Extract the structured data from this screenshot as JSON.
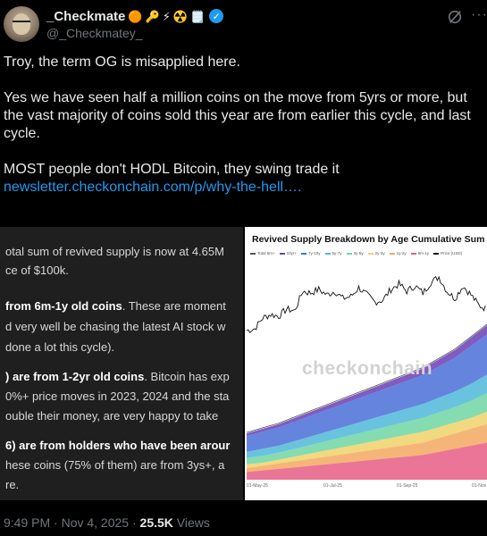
{
  "author": {
    "name": "_Checkmate",
    "handle": "@_Checkmatey_",
    "badges": [
      "🟠",
      "🔑",
      "⚡",
      "☢️",
      "🗒️"
    ],
    "verified_icon": "verified-check-icon"
  },
  "actions": {
    "grok_icon": "grok-icon",
    "more_label": "···"
  },
  "tweet": {
    "para1": "Troy, the term OG is misapplied here.",
    "para2": "Yes we have seen half a million coins on the move from 5yrs or more, but the vast majority of coins sold this year are from earlier this cycle, and last cycle.",
    "para3": "MOST people don't HODL Bitcoin, they swing trade it",
    "link": "newsletter.checkonchain.com/p/why-the-hell…."
  },
  "left_image": {
    "line1": "otal sum of revived supply is now at 4.65M",
    "line2": "ce of $100k.",
    "line3_bold": "from 6m-1y old coins",
    "line3_rest": ". These are moment",
    "line4": "d very well be chasing the latest AI stock w",
    "line5": "done a lot this cycle).",
    "line6_bold": ") are from 1-2yr old coins",
    "line6_rest": ". Bitcoin has exp",
    "line7": "0%+ price moves in 2023, 2024 and the sta",
    "line8": "ouble their money, are very happy to take",
    "line9_bold": "6) are from holders who have been arour",
    "line10": "hese coins (75% of them) are from 3ys+, a",
    "line11": "re."
  },
  "chart_data": {
    "type": "area",
    "title": "Revived Supply Breakdown by Age Cumulative Sum",
    "watermark": "checkonchain",
    "legend": [
      {
        "name": "Total 6m+",
        "color": "#555555"
      },
      {
        "name": "10yr+",
        "color": "#6a3fb5"
      },
      {
        "name": "7y-10y",
        "color": "#4a6fd8"
      },
      {
        "name": "5y-7y",
        "color": "#4fb8d8"
      },
      {
        "name": "3y-5y",
        "color": "#6ed6a2"
      },
      {
        "name": "2y-3y",
        "color": "#f0d268"
      },
      {
        "name": "1y-2y",
        "color": "#f4a860"
      },
      {
        "name": "6m-1y",
        "color": "#e85d84"
      },
      {
        "name": "Price (USD)",
        "color": "#111111"
      }
    ],
    "x_ticks": [
      "01-May-25",
      "01-Jul-25",
      "01-Sep-25",
      "01-Nov"
    ],
    "stack_fractions": [
      [
        0.3,
        0.33,
        0.36,
        0.4,
        0.44,
        0.48,
        0.52,
        0.56,
        0.6,
        0.64,
        0.68,
        0.72,
        0.78,
        0.84,
        0.92,
        1.0
      ],
      [
        0.18,
        0.2,
        0.22,
        0.25,
        0.28,
        0.31,
        0.34,
        0.37,
        0.4,
        0.43,
        0.46,
        0.49,
        0.53,
        0.57,
        0.62,
        0.68
      ],
      [
        0.1,
        0.11,
        0.13,
        0.15,
        0.17,
        0.19,
        0.21,
        0.23,
        0.25,
        0.27,
        0.29,
        0.31,
        0.34,
        0.37,
        0.4,
        0.44
      ],
      [
        0.05,
        0.06,
        0.07,
        0.08,
        0.09,
        0.1,
        0.11,
        0.12,
        0.13,
        0.14,
        0.15,
        0.16,
        0.18,
        0.2,
        0.22,
        0.24
      ]
    ],
    "price_series": [
      96,
      97,
      103,
      105,
      104,
      108,
      107,
      118,
      117,
      119,
      116,
      118,
      114,
      115,
      120,
      116,
      112,
      113,
      119,
      122,
      118,
      121,
      117,
      123,
      126,
      118,
      114,
      121,
      116,
      110,
      108
    ]
  },
  "meta": {
    "time": "9:49 PM · Nov 4, 2025 · ",
    "views_count": "25.5K",
    "views_label": " Views"
  }
}
